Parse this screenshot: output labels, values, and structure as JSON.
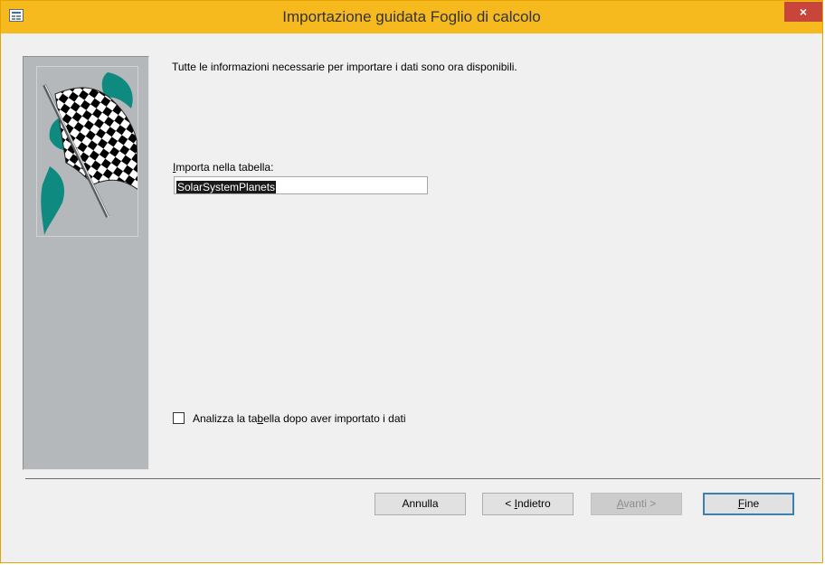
{
  "window": {
    "title": "Importazione guidata Foglio di calcolo",
    "close_glyph": "×"
  },
  "content": {
    "info": "Tutte le informazioni necessarie per importare i dati sono ora disponibili.",
    "import_label_accel": "I",
    "import_label_rest": "mporta nella tabella:",
    "table_name": "SolarSystemPlanets",
    "analyze_pre": "Analizza la ta",
    "analyze_accel": "b",
    "analyze_post": "ella dopo aver importato i dati",
    "analyze_checked": false
  },
  "buttons": {
    "cancel": "Annulla",
    "back_prefix": "< ",
    "back_accel": "I",
    "back_rest": "ndietro",
    "next_accel": "A",
    "next_rest": "vanti >",
    "finish_accel": "F",
    "finish_rest": "ine"
  },
  "icons": {
    "app": "form-icon",
    "close": "close-icon",
    "flag": "checkered-flag-icon"
  },
  "colors": {
    "titlebar": "#f6b91e",
    "close": "#c7453a",
    "panel": "#b5b8ba",
    "accent": "#3c7fb1",
    "teal": "#0f8a80"
  }
}
